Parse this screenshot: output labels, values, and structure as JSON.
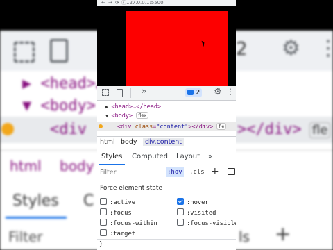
{
  "browser": {
    "url": "127.0.0.1:5500",
    "nav_icons": [
      "arrow-left-icon",
      "arrow-right-icon",
      "reload-icon",
      "info-icon"
    ]
  },
  "devtools": {
    "toolbar": {
      "tab_more": "»",
      "issues_count": "2"
    },
    "elements": {
      "head_line": "<head>…</head>",
      "body_open": "<body>",
      "body_badge": "flex",
      "div_line_tag_open": "<div ",
      "div_attr_name": "class",
      "div_attr_value": "\"content\"",
      "div_line_close": "></div>",
      "div_badge": "fle"
    },
    "breadcrumb": [
      "html",
      "body",
      "div.content"
    ],
    "panel_tabs": [
      "Styles",
      "Computed",
      "Layout",
      "»"
    ],
    "styles": {
      "filter_placeholder": "Filter",
      "hov_label": ":hov",
      "cls_label": ".cls",
      "add_label": "+"
    },
    "force_state": {
      "title": "Force element state",
      "states": [
        {
          "label": ":active",
          "checked": false
        },
        {
          "label": ":hover",
          "checked": true
        },
        {
          "label": ":focus",
          "checked": false
        },
        {
          "label": ":visited",
          "checked": false
        },
        {
          "label": ":focus-within",
          "checked": false
        },
        {
          "label": ":focus-visible",
          "checked": false
        },
        {
          "label": ":target",
          "checked": false
        }
      ]
    },
    "closing_brace": "}"
  },
  "background_zoom": {
    "head": "▶ <head>…",
    "body": "▼ <body>",
    "div": "<div",
    "div_close": "></div>",
    "flex": "fle",
    "crumb_html": "html",
    "crumb_body": "body",
    "tab_styles": "Styles",
    "tab_c": "C",
    "filter": "Filter",
    "cls": "ls",
    "plus": "+",
    "issues": "2"
  },
  "colors": {
    "viewport_red": "#fd0000",
    "accent_blue": "#1a73e8",
    "tag_purple": "#881280"
  }
}
